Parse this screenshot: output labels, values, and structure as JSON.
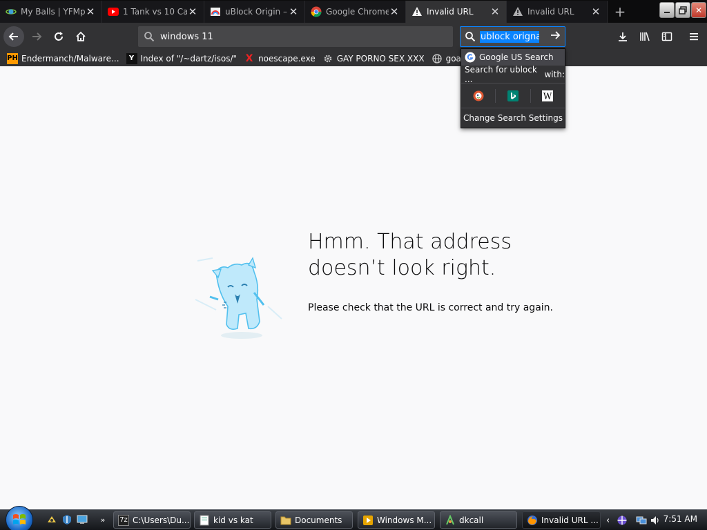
{
  "tabs": [
    {
      "title": "My Balls | YFMp",
      "active": false
    },
    {
      "title": "1 Tank vs 10 Ca",
      "active": false
    },
    {
      "title": "uBlock Origin –",
      "active": false
    },
    {
      "title": "Google Chrome",
      "active": false
    },
    {
      "title": "Invalid URL",
      "active": true
    },
    {
      "title": "Invalid URL",
      "active": false
    }
  ],
  "urlbar": {
    "value": "windows 11"
  },
  "searchbar": {
    "value": "ublock orignal"
  },
  "bookmarks": [
    {
      "label": "Endermanch/Malware...",
      "icon": "PH"
    },
    {
      "label": "Index of \"/~dartz/isos/\"",
      "icon": "Y"
    },
    {
      "label": "noescape.exe",
      "icon": "X"
    },
    {
      "label": "GAY PORNO SEX XXX",
      "icon": "gear"
    },
    {
      "label": "goatse.info",
      "icon": "globe"
    }
  ],
  "search_popup": {
    "default_engine": "Google US Search",
    "search_for_label": "Search for ublock ...",
    "with_label": "with:",
    "engines": [
      "duckduckgo-icon",
      "bing-icon",
      "wikipedia-icon"
    ],
    "settings_label": "Change Search Settings"
  },
  "error": {
    "title": "Hmm. That address doesn’t look right.",
    "description": "Please check that the URL is correct and try again."
  },
  "taskbar": {
    "buttons": [
      {
        "label": "C:\\Users\\Du...",
        "active": false
      },
      {
        "label": "kid vs kat",
        "active": false
      },
      {
        "label": "Documents",
        "active": false
      },
      {
        "label": "Windows M...",
        "active": false
      },
      {
        "label": "dkcall",
        "active": false
      },
      {
        "label": "Invalid URL ...",
        "active": true
      }
    ],
    "clock": "7:51 AM"
  },
  "colors": {
    "accent": "#0a84ff",
    "toolbar": "#323234",
    "tabstrip": "#0c0c0d",
    "content_bg": "#f9f9fa"
  }
}
